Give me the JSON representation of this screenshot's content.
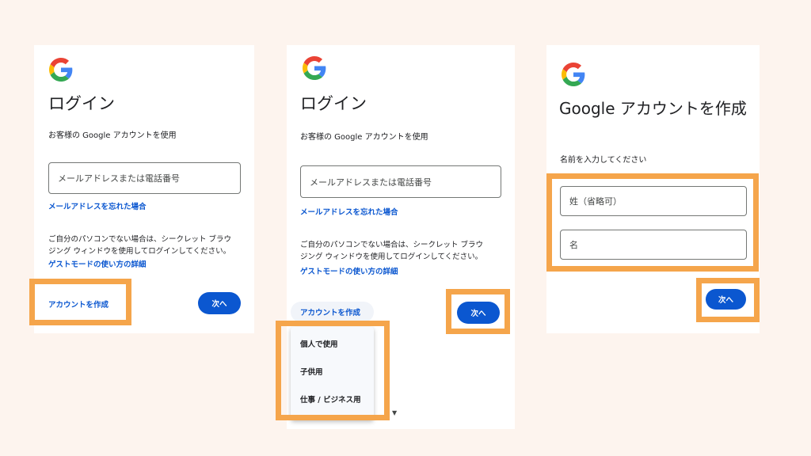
{
  "panel1": {
    "title": "ログイン",
    "subtitle": "お客様の Google アカウントを使用",
    "email_placeholder": "メールアドレスまたは電話番号",
    "forgot_email": "メールアドレスを忘れた場合",
    "guest_note_line1": "ご自分のパソコンでない場合は、シークレット ブラウ",
    "guest_note_line2": "ジング ウィンドウを使用してログインしてください。",
    "guest_link": "ゲストモードの使い方の詳細",
    "create_account": "アカウントを作成",
    "next": "次へ"
  },
  "panel2": {
    "title": "ログイン",
    "subtitle": "お客様の Google アカウントを使用",
    "email_placeholder": "メールアドレスまたは電話番号",
    "forgot_email": "メールアドレスを忘れた場合",
    "guest_note_line1": "ご自分のパソコンでない場合は、シークレット ブラウ",
    "guest_note_line2": "ジング ウィンドウを使用してログインしてください。",
    "guest_link": "ゲストモードの使い方の詳細",
    "create_account": "アカウントを作成",
    "next": "次へ",
    "menu_items": [
      "個人で使用",
      "子供用",
      "仕事 / ビジネス用"
    ]
  },
  "panel3": {
    "title": "Google アカウントを作成",
    "subtitle": "名前を入力してください",
    "last_name_placeholder": "姓（省略可）",
    "first_name_placeholder": "名",
    "next": "次へ"
  },
  "colors": {
    "background": "#fdf4ee",
    "highlight": "#f5a54b",
    "primary_button": "#0b57d0",
    "link": "#0b57d0"
  },
  "icons": {
    "logo": "google-g-logo",
    "dropdown_caret": "caret-down-icon"
  }
}
